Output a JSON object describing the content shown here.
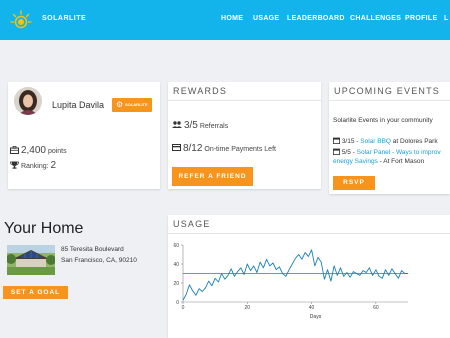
{
  "app": {
    "brand": "SOLARLITE"
  },
  "nav": {
    "items": [
      "HOME",
      "USAGE",
      "LEADERBOARD",
      "CHALLENGES",
      "PROFILE",
      "L"
    ]
  },
  "profile": {
    "name": "Lupita Davila",
    "badge_label": "SOLARLITE",
    "points_value": "2,400",
    "points_label": "points",
    "ranking_label": "Ranking:",
    "ranking_value": "2"
  },
  "rewards": {
    "title": "REWARDS",
    "referrals_value": "3/5",
    "referrals_label": "Referrals",
    "payments_value": "8/12",
    "payments_label": "On-time Payments Left",
    "button": "REFER A FRIEND"
  },
  "events": {
    "title": "UPCOMING EVENTS",
    "intro": "Solarlite Events in your community",
    "e1_date": "3/15 -",
    "e1_link": "Solar BBQ",
    "e1_rest": "at Dolores Park",
    "e2_date": "5/5 -",
    "e2_link_a": "Solar Panel - Ways to improv",
    "e2_link_b": "energy Savings",
    "e2_rest": "- At Fort Mason",
    "button": "RSVP"
  },
  "home": {
    "title": "Your Home",
    "address_line1": "85 Teresita Boulevard",
    "address_line2": "San Francisco, CA, 90210",
    "button": "SET A GOAL"
  },
  "usage": {
    "title": "USAGE"
  },
  "colors": {
    "nav_bg": "#13b4ec",
    "accent": "#f7941d",
    "line": "#1a7fb5",
    "target_line": "#22b7d8",
    "link": "#1a9fd9"
  },
  "chart_data": {
    "type": "line",
    "xlabel": "Days",
    "ylabel": "",
    "xlim": [
      0,
      70
    ],
    "ylim": [
      0,
      60
    ],
    "x_ticks": [
      0,
      20,
      40,
      60
    ],
    "y_ticks": [
      0,
      20,
      40,
      60
    ],
    "target": 30,
    "series": [
      {
        "values": [
          [
            0,
            2
          ],
          [
            1,
            8
          ],
          [
            2,
            18
          ],
          [
            3,
            12
          ],
          [
            4,
            7
          ],
          [
            5,
            14
          ],
          [
            6,
            11
          ],
          [
            7,
            15
          ],
          [
            8,
            22
          ],
          [
            9,
            17
          ],
          [
            10,
            25
          ],
          [
            11,
            21
          ],
          [
            12,
            30
          ],
          [
            13,
            24
          ],
          [
            14,
            28
          ],
          [
            15,
            35
          ],
          [
            16,
            27
          ],
          [
            17,
            32
          ],
          [
            18,
            36
          ],
          [
            19,
            29
          ],
          [
            20,
            40
          ],
          [
            21,
            33
          ],
          [
            22,
            38
          ],
          [
            23,
            31
          ],
          [
            24,
            42
          ],
          [
            25,
            36
          ],
          [
            26,
            45
          ],
          [
            27,
            38
          ],
          [
            28,
            41
          ],
          [
            29,
            34
          ],
          [
            30,
            37
          ],
          [
            31,
            30
          ],
          [
            32,
            27
          ],
          [
            33,
            34
          ],
          [
            34,
            40
          ],
          [
            35,
            46
          ],
          [
            36,
            50
          ],
          [
            37,
            45
          ],
          [
            38,
            52
          ],
          [
            39,
            48
          ],
          [
            40,
            55
          ],
          [
            41,
            38
          ],
          [
            42,
            47
          ],
          [
            43,
            42
          ],
          [
            44,
            24
          ],
          [
            45,
            34
          ],
          [
            46,
            22
          ],
          [
            47,
            38
          ],
          [
            48,
            28
          ],
          [
            49,
            36
          ],
          [
            50,
            27
          ],
          [
            51,
            31
          ],
          [
            52,
            26
          ],
          [
            53,
            32
          ],
          [
            54,
            30
          ],
          [
            55,
            28
          ],
          [
            56,
            33
          ],
          [
            57,
            31
          ],
          [
            58,
            36
          ],
          [
            59,
            28
          ],
          [
            60,
            34
          ],
          [
            61,
            27
          ],
          [
            62,
            25
          ],
          [
            63,
            34
          ],
          [
            64,
            28
          ],
          [
            65,
            35
          ],
          [
            66,
            30
          ],
          [
            67,
            25
          ],
          [
            68,
            33
          ],
          [
            69,
            30
          ],
          [
            70,
            30
          ]
        ]
      }
    ]
  }
}
